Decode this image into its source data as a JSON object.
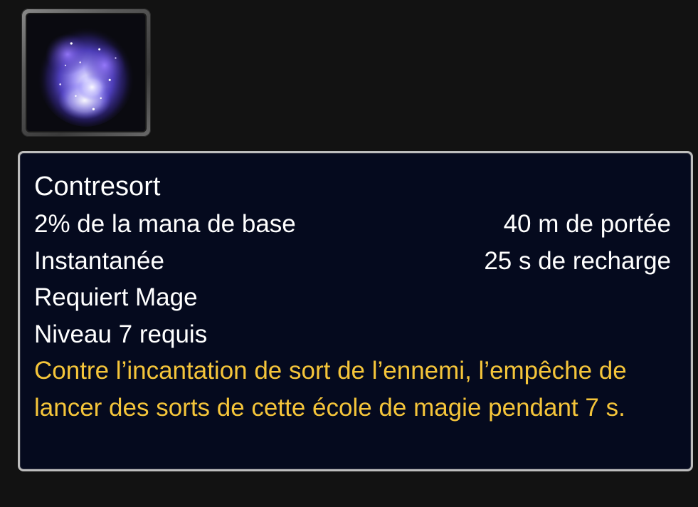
{
  "spell": {
    "icon": "counterspell-arcane-icon",
    "name": "Contresort",
    "cost": "2% de la mana de base",
    "range": "40 m de portée",
    "cast_time": "Instantanée",
    "cooldown": "25 s de recharge",
    "requires_class": "Requiert Mage",
    "required_level": "Niveau 7 requis",
    "description": "Contre l’incantation de sort de l’ennemi, l’empêche de lancer des sorts de cette école de magie pendant 7 s."
  },
  "colors": {
    "background": "#121212",
    "tooltip_background": "#050a1e",
    "tooltip_border": "#bdbdbd",
    "text_white": "#ffffff",
    "text_description": "#f5c53a"
  }
}
